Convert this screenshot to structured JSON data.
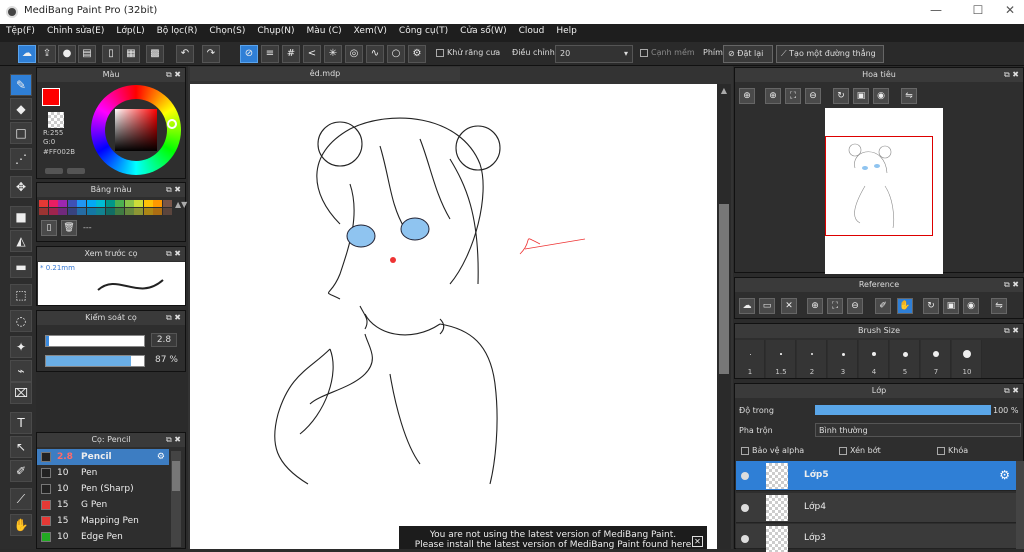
{
  "window": {
    "title": "MediBang Paint Pro (32bit)",
    "minimize": "—",
    "maximize": "☐",
    "close": "✕"
  },
  "menu": [
    "Tệp(F)",
    "Chỉnh sửa(E)",
    "Lớp(L)",
    "Bộ lọc(R)",
    "Chọn(S)",
    "Chụp(N)",
    "Màu (C)",
    "Xem(V)",
    "Công cụ(T)",
    "Cửa sổ(W)",
    "Cloud",
    "Help"
  ],
  "toolbar": {
    "antialias_label": "Khử răng cưa",
    "adjust_label": "Điều chỉnh",
    "adjust_value": "20",
    "edge_soft_label": "Cạnh mềm",
    "key_label": "Phím",
    "reset_label": "Đặt lại",
    "straight_line_label": "Tạo một đường thẳng"
  },
  "color_panel": {
    "title": "Màu",
    "r": "R:255",
    "g": "G:0",
    "b": "B:0",
    "hex": "#FF002B",
    "accent": "#ff0000"
  },
  "palette_panel": {
    "title": "Bảng màu",
    "dash": "---",
    "colors": [
      "#e53935",
      "#e91e63",
      "#9c27b0",
      "#3f51b5",
      "#2196f3",
      "#03a9f4",
      "#00bcd4",
      "#009688",
      "#4caf50",
      "#8bc34a",
      "#cddc39",
      "#ffc107",
      "#ff9800",
      "#795548"
    ]
  },
  "preview_panel": {
    "title": "Xem trước cọ",
    "size": "* 0.21mm"
  },
  "brush_control": {
    "title": "Kiểm soát cọ",
    "size": "2.8",
    "opacity": "87 %",
    "size_fraction": 0.03,
    "opacity_fraction": 0.87
  },
  "brush_list": {
    "title": "Cọ: Pencil",
    "items": [
      {
        "size": "2.8",
        "name": "Pencil",
        "color": "#222222"
      },
      {
        "size": "10",
        "name": "Pen",
        "color": "#222222"
      },
      {
        "size": "10",
        "name": "Pen (Sharp)",
        "color": "#222222"
      },
      {
        "size": "15",
        "name": "G Pen",
        "color": "#e53935"
      },
      {
        "size": "15",
        "name": "Mapping Pen",
        "color": "#e53935"
      },
      {
        "size": "10",
        "name": "Edge Pen",
        "color": "#22aa22"
      }
    ]
  },
  "document": {
    "tab": "êd.mdp"
  },
  "navigator": {
    "title": "Hoa tiêu"
  },
  "reference": {
    "title": "Reference"
  },
  "brush_size": {
    "title": "Brush Size",
    "sizes": [
      "1",
      "1.5",
      "2",
      "3",
      "4",
      "5",
      "7",
      "10"
    ]
  },
  "layers": {
    "title": "Lớp",
    "opacity_label": "Độ trong",
    "opacity_value": "100 %",
    "blend_label": "Pha trộn",
    "blend_value": "Bình thường",
    "protect_alpha": "Bảo vệ alpha",
    "clipping": "Xén bớt",
    "lock": "Khóa",
    "items": [
      "Lớp5",
      "Lớp4",
      "Lớp3"
    ]
  },
  "toast": {
    "line1": "You are not using the latest version of MediBang Paint.",
    "line2": "Please install the latest version of MediBang Paint found here",
    "close": "✕"
  }
}
